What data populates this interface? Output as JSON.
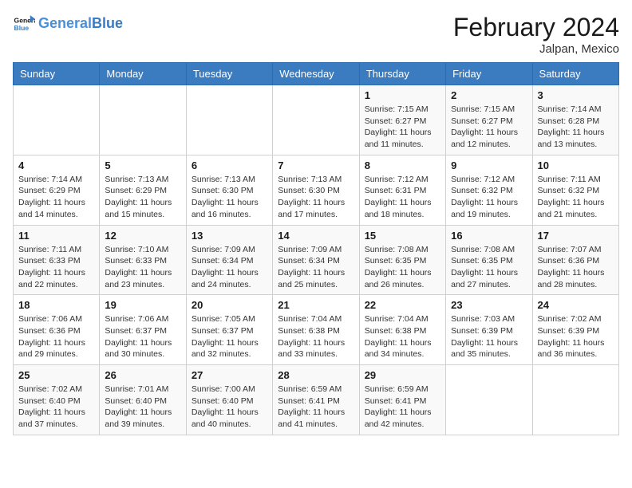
{
  "header": {
    "logo_general": "General",
    "logo_blue": "Blue",
    "month_title": "February 2024",
    "location": "Jalpan, Mexico"
  },
  "weekdays": [
    "Sunday",
    "Monday",
    "Tuesday",
    "Wednesday",
    "Thursday",
    "Friday",
    "Saturday"
  ],
  "weeks": [
    [
      null,
      null,
      null,
      null,
      {
        "date": 1,
        "sunrise": "Sunrise: 7:15 AM",
        "sunset": "Sunset: 6:27 PM",
        "daylight": "Daylight: 11 hours and 11 minutes."
      },
      {
        "date": 2,
        "sunrise": "Sunrise: 7:15 AM",
        "sunset": "Sunset: 6:27 PM",
        "daylight": "Daylight: 11 hours and 12 minutes."
      },
      {
        "date": 3,
        "sunrise": "Sunrise: 7:14 AM",
        "sunset": "Sunset: 6:28 PM",
        "daylight": "Daylight: 11 hours and 13 minutes."
      }
    ],
    [
      {
        "date": 4,
        "sunrise": "Sunrise: 7:14 AM",
        "sunset": "Sunset: 6:29 PM",
        "daylight": "Daylight: 11 hours and 14 minutes."
      },
      {
        "date": 5,
        "sunrise": "Sunrise: 7:13 AM",
        "sunset": "Sunset: 6:29 PM",
        "daylight": "Daylight: 11 hours and 15 minutes."
      },
      {
        "date": 6,
        "sunrise": "Sunrise: 7:13 AM",
        "sunset": "Sunset: 6:30 PM",
        "daylight": "Daylight: 11 hours and 16 minutes."
      },
      {
        "date": 7,
        "sunrise": "Sunrise: 7:13 AM",
        "sunset": "Sunset: 6:30 PM",
        "daylight": "Daylight: 11 hours and 17 minutes."
      },
      {
        "date": 8,
        "sunrise": "Sunrise: 7:12 AM",
        "sunset": "Sunset: 6:31 PM",
        "daylight": "Daylight: 11 hours and 18 minutes."
      },
      {
        "date": 9,
        "sunrise": "Sunrise: 7:12 AM",
        "sunset": "Sunset: 6:32 PM",
        "daylight": "Daylight: 11 hours and 19 minutes."
      },
      {
        "date": 10,
        "sunrise": "Sunrise: 7:11 AM",
        "sunset": "Sunset: 6:32 PM",
        "daylight": "Daylight: 11 hours and 21 minutes."
      }
    ],
    [
      {
        "date": 11,
        "sunrise": "Sunrise: 7:11 AM",
        "sunset": "Sunset: 6:33 PM",
        "daylight": "Daylight: 11 hours and 22 minutes."
      },
      {
        "date": 12,
        "sunrise": "Sunrise: 7:10 AM",
        "sunset": "Sunset: 6:33 PM",
        "daylight": "Daylight: 11 hours and 23 minutes."
      },
      {
        "date": 13,
        "sunrise": "Sunrise: 7:09 AM",
        "sunset": "Sunset: 6:34 PM",
        "daylight": "Daylight: 11 hours and 24 minutes."
      },
      {
        "date": 14,
        "sunrise": "Sunrise: 7:09 AM",
        "sunset": "Sunset: 6:34 PM",
        "daylight": "Daylight: 11 hours and 25 minutes."
      },
      {
        "date": 15,
        "sunrise": "Sunrise: 7:08 AM",
        "sunset": "Sunset: 6:35 PM",
        "daylight": "Daylight: 11 hours and 26 minutes."
      },
      {
        "date": 16,
        "sunrise": "Sunrise: 7:08 AM",
        "sunset": "Sunset: 6:35 PM",
        "daylight": "Daylight: 11 hours and 27 minutes."
      },
      {
        "date": 17,
        "sunrise": "Sunrise: 7:07 AM",
        "sunset": "Sunset: 6:36 PM",
        "daylight": "Daylight: 11 hours and 28 minutes."
      }
    ],
    [
      {
        "date": 18,
        "sunrise": "Sunrise: 7:06 AM",
        "sunset": "Sunset: 6:36 PM",
        "daylight": "Daylight: 11 hours and 29 minutes."
      },
      {
        "date": 19,
        "sunrise": "Sunrise: 7:06 AM",
        "sunset": "Sunset: 6:37 PM",
        "daylight": "Daylight: 11 hours and 30 minutes."
      },
      {
        "date": 20,
        "sunrise": "Sunrise: 7:05 AM",
        "sunset": "Sunset: 6:37 PM",
        "daylight": "Daylight: 11 hours and 32 minutes."
      },
      {
        "date": 21,
        "sunrise": "Sunrise: 7:04 AM",
        "sunset": "Sunset: 6:38 PM",
        "daylight": "Daylight: 11 hours and 33 minutes."
      },
      {
        "date": 22,
        "sunrise": "Sunrise: 7:04 AM",
        "sunset": "Sunset: 6:38 PM",
        "daylight": "Daylight: 11 hours and 34 minutes."
      },
      {
        "date": 23,
        "sunrise": "Sunrise: 7:03 AM",
        "sunset": "Sunset: 6:39 PM",
        "daylight": "Daylight: 11 hours and 35 minutes."
      },
      {
        "date": 24,
        "sunrise": "Sunrise: 7:02 AM",
        "sunset": "Sunset: 6:39 PM",
        "daylight": "Daylight: 11 hours and 36 minutes."
      }
    ],
    [
      {
        "date": 25,
        "sunrise": "Sunrise: 7:02 AM",
        "sunset": "Sunset: 6:40 PM",
        "daylight": "Daylight: 11 hours and 37 minutes."
      },
      {
        "date": 26,
        "sunrise": "Sunrise: 7:01 AM",
        "sunset": "Sunset: 6:40 PM",
        "daylight": "Daylight: 11 hours and 39 minutes."
      },
      {
        "date": 27,
        "sunrise": "Sunrise: 7:00 AM",
        "sunset": "Sunset: 6:40 PM",
        "daylight": "Daylight: 11 hours and 40 minutes."
      },
      {
        "date": 28,
        "sunrise": "Sunrise: 6:59 AM",
        "sunset": "Sunset: 6:41 PM",
        "daylight": "Daylight: 11 hours and 41 minutes."
      },
      {
        "date": 29,
        "sunrise": "Sunrise: 6:59 AM",
        "sunset": "Sunset: 6:41 PM",
        "daylight": "Daylight: 11 hours and 42 minutes."
      },
      null,
      null
    ]
  ]
}
